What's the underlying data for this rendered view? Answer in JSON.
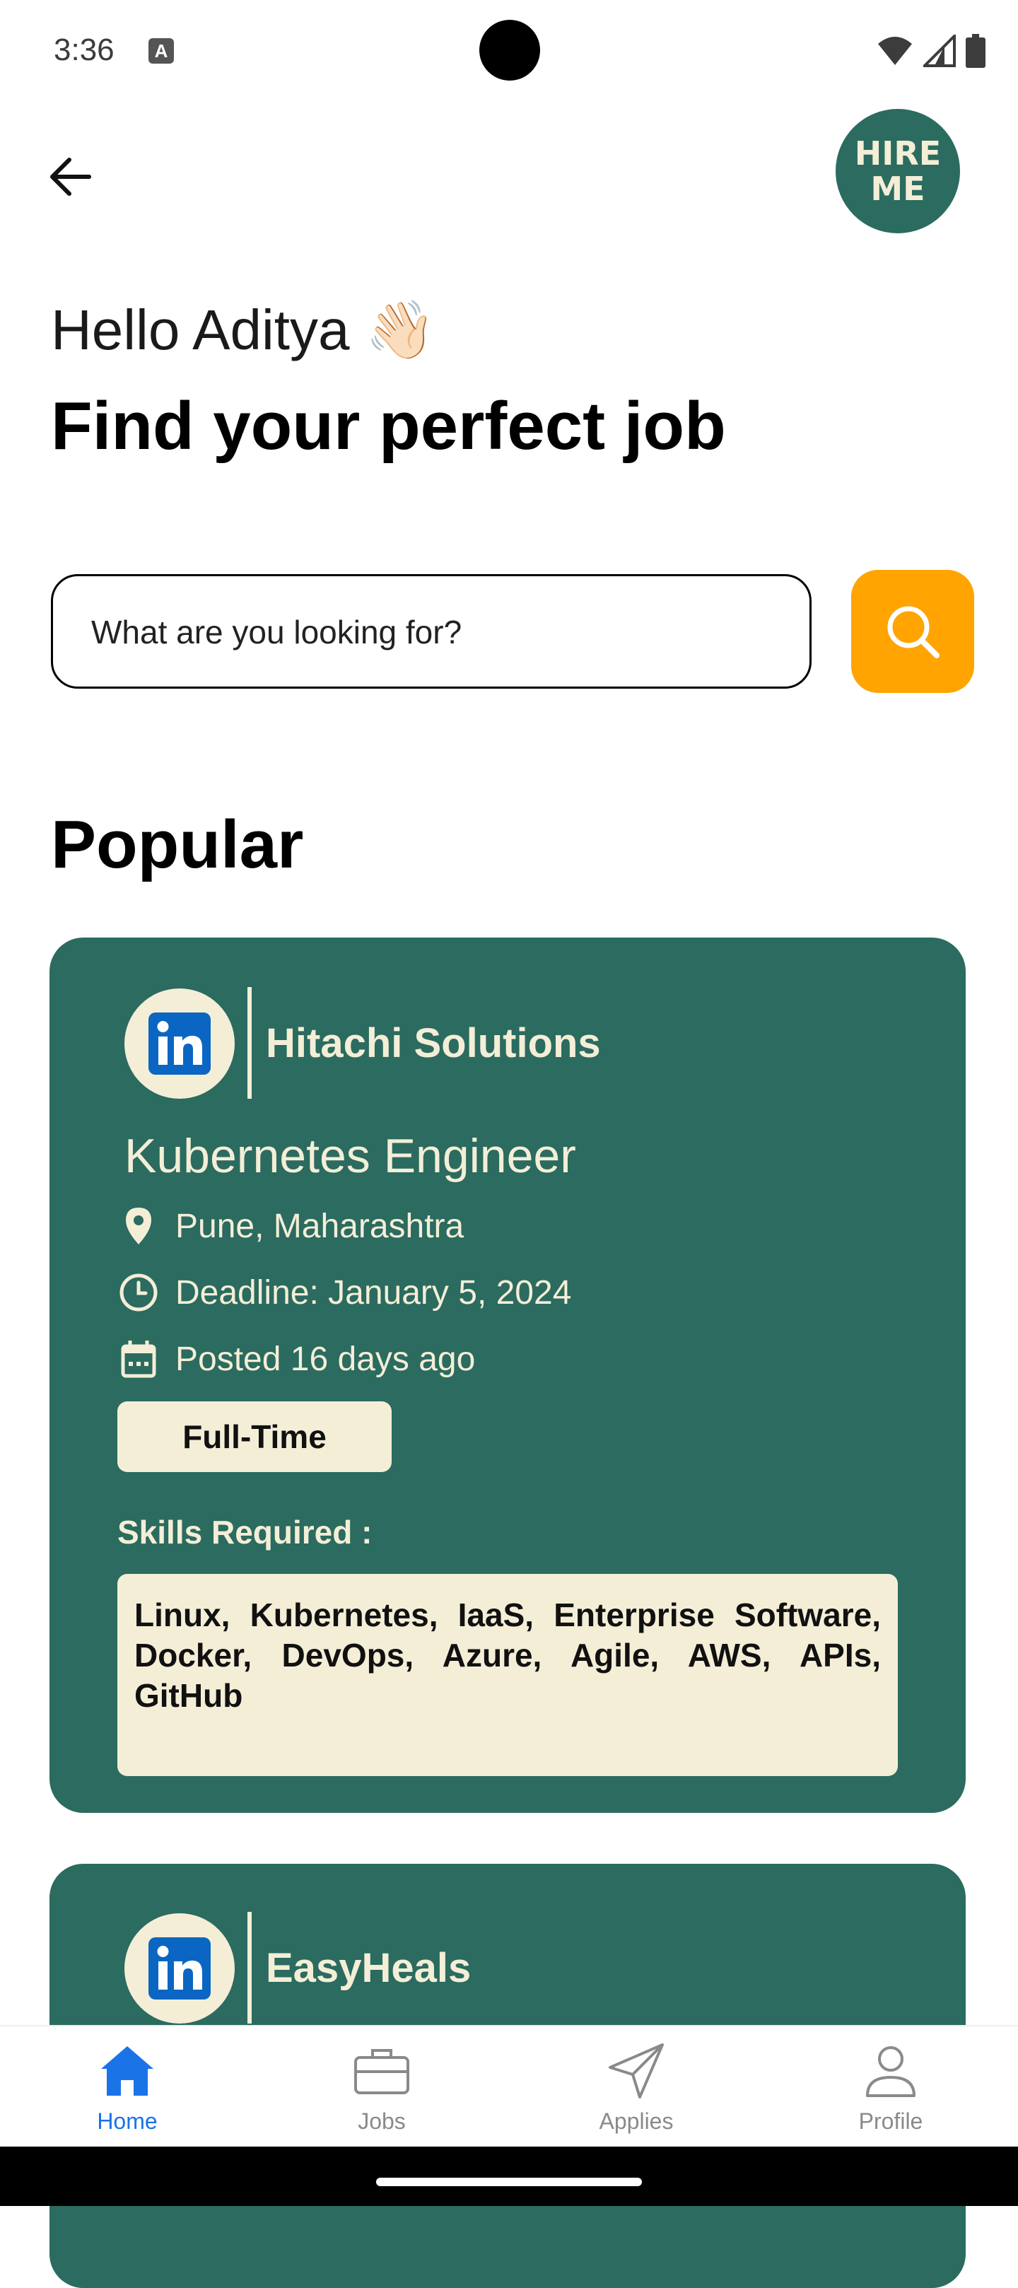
{
  "status_bar": {
    "time": "3:36",
    "notification_icon": "A"
  },
  "app_bar": {
    "back_icon": "arrow-left-icon",
    "logo_line1": "HIRE",
    "logo_line2": "ME"
  },
  "greeting": "Hello Aditya 👋🏻",
  "headline": "Find your perfect job",
  "search": {
    "placeholder": "What are you looking for?",
    "button_icon": "search-icon",
    "accent_color": "#ffa400"
  },
  "section_title": "Popular",
  "theme": {
    "card_color": "#2b6b60",
    "card_text_color": "#f4eed7",
    "nav_active_color": "#1b73e8"
  },
  "jobs": [
    {
      "company": "Hitachi Solutions",
      "logo": "linkedin-icon",
      "title": "Kubernetes Engineer",
      "location": "Pune, Maharashtra",
      "deadline": "Deadline: January 5, 2024",
      "posted": "Posted 16 days ago",
      "type": "Full-Time",
      "skills_label": "Skills Required :",
      "skills": "Linux, Kubernetes, IaaS, Enterprise Software, Docker, DevOps, Azure, Agile, AWS, APIs, GitHub"
    },
    {
      "company": "EasyHeals",
      "logo": "linkedin-icon"
    }
  ],
  "bottom_nav": [
    {
      "label": "Home",
      "icon": "home-icon",
      "active": true
    },
    {
      "label": "Jobs",
      "icon": "briefcase-icon",
      "active": false
    },
    {
      "label": "Applies",
      "icon": "send-icon",
      "active": false
    },
    {
      "label": "Profile",
      "icon": "person-icon",
      "active": false
    }
  ]
}
